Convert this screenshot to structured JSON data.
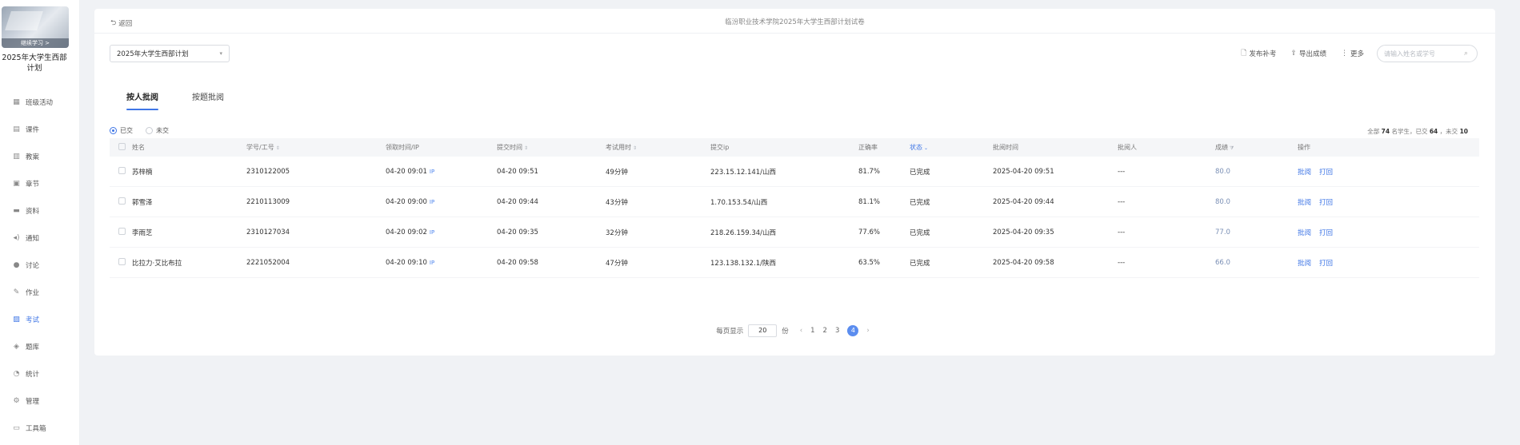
{
  "sidebar": {
    "cover_text": "继续学习 >",
    "course_title": "2025年大学生西部计划",
    "items": [
      {
        "label": "班级活动",
        "icon": "grid-icon"
      },
      {
        "label": "课件",
        "icon": "file-icon"
      },
      {
        "label": "教案",
        "icon": "document-icon"
      },
      {
        "label": "章节",
        "icon": "chapter-icon"
      },
      {
        "label": "资料",
        "icon": "folder-icon"
      },
      {
        "label": "通知",
        "icon": "speaker-icon"
      },
      {
        "label": "讨论",
        "icon": "chat-icon"
      },
      {
        "label": "作业",
        "icon": "edit-icon"
      },
      {
        "label": "考试",
        "icon": "exam-icon",
        "active": true
      },
      {
        "label": "题库",
        "icon": "layers-icon"
      },
      {
        "label": "统计",
        "icon": "pie-chart-icon"
      },
      {
        "label": "管理",
        "icon": "gear-icon"
      },
      {
        "label": "工具箱",
        "icon": "toolbox-icon"
      }
    ]
  },
  "header": {
    "back_label": "返回",
    "title": "临汾职业技术学院2025年大学生西部计划试卷"
  },
  "filter": {
    "plan_value": "2025年大学生西部计划"
  },
  "toolbar": {
    "publish_label": "发布补考",
    "export_label": "导出成绩",
    "more_label": "更多",
    "search_placeholder": "请输入姓名或学号"
  },
  "tabs": [
    {
      "label": "按人批阅",
      "active": true
    },
    {
      "label": "按题批阅",
      "active": false
    }
  ],
  "radios": [
    {
      "label": "已交",
      "checked": true
    },
    {
      "label": "未交",
      "checked": false
    }
  ],
  "summary": {
    "prefix": "全部",
    "total": "74",
    "mid1": "名学生，已交",
    "submitted": "64",
    "mid2": "，未交",
    "unsubmitted": "10"
  },
  "table": {
    "headers": {
      "name": "姓名",
      "id": "学号/工号",
      "take_time": "领取时间/IP",
      "submit_time": "提交时间",
      "duration": "考试用时",
      "ip": "提交ip",
      "accuracy": "正确率",
      "status": "状态",
      "review_time": "批阅时间",
      "reviewer": "批阅人",
      "score": "成绩",
      "ops": "操作"
    },
    "ip_badge": "IP",
    "op_review": "批阅",
    "op_print": "打回",
    "rows": [
      {
        "name": "苏梓楠",
        "id": "2310122005",
        "take_time": "04-20 09:01",
        "submit_time": "04-20 09:51",
        "duration": "49分钟",
        "ip": "223.15.12.141/山西",
        "accuracy": "81.7%",
        "status": "已完成",
        "review_time": "2025-04-20 09:51",
        "reviewer": "---",
        "score": "80.0"
      },
      {
        "name": "郭雪泽",
        "id": "2210113009",
        "take_time": "04-20 09:00",
        "submit_time": "04-20 09:44",
        "duration": "43分钟",
        "ip": "1.70.153.54/山西",
        "accuracy": "81.1%",
        "status": "已完成",
        "review_time": "2025-04-20 09:44",
        "reviewer": "---",
        "score": "80.0"
      },
      {
        "name": "李雨芝",
        "id": "2310127034",
        "take_time": "04-20 09:02",
        "submit_time": "04-20 09:35",
        "duration": "32分钟",
        "ip": "218.26.159.34/山西",
        "accuracy": "77.6%",
        "status": "已完成",
        "review_time": "2025-04-20 09:35",
        "reviewer": "---",
        "score": "77.0"
      },
      {
        "name": "比拉力·艾比布拉",
        "id": "2221052004",
        "take_time": "04-20 09:10",
        "submit_time": "04-20 09:58",
        "duration": "47分钟",
        "ip": "123.138.132.1/陕西",
        "accuracy": "63.5%",
        "status": "已完成",
        "review_time": "2025-04-20 09:58",
        "reviewer": "---",
        "score": "66.0"
      }
    ]
  },
  "pagination": {
    "per_page_label": "每页显示",
    "per_page_value": "20",
    "unit": "份",
    "pages": [
      "1",
      "2",
      "3",
      "4"
    ],
    "current_page": "4"
  },
  "colors": {
    "accent": "#3f76e6",
    "background": "#f0f2f5"
  }
}
